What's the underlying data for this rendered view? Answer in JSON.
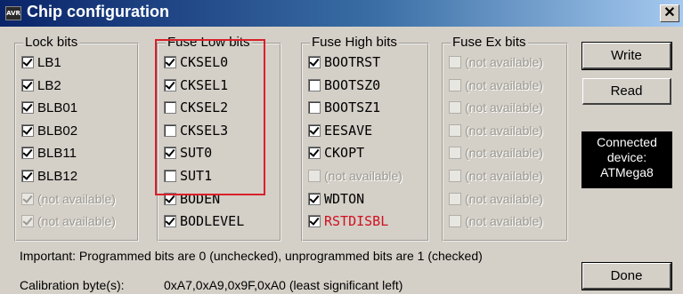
{
  "window": {
    "title": "Chip configuration",
    "app_icon_text": "AVR",
    "close_symbol": "✕"
  },
  "lock_bits": {
    "title": "Lock bits",
    "items": [
      {
        "label": "LB1",
        "checked": true,
        "available": true
      },
      {
        "label": "LB2",
        "checked": true,
        "available": true
      },
      {
        "label": "BLB01",
        "checked": true,
        "available": true
      },
      {
        "label": "BLB02",
        "checked": true,
        "available": true
      },
      {
        "label": "BLB11",
        "checked": true,
        "available": true
      },
      {
        "label": "BLB12",
        "checked": true,
        "available": true
      },
      {
        "label": "(not available)",
        "checked": true,
        "available": false
      },
      {
        "label": "(not available)",
        "checked": true,
        "available": false
      }
    ]
  },
  "fuse_low": {
    "title": "Fuse Low bits",
    "items": [
      {
        "label": "CKSEL0",
        "checked": true
      },
      {
        "label": "CKSEL1",
        "checked": true
      },
      {
        "label": "CKSEL2",
        "checked": false
      },
      {
        "label": "CKSEL3",
        "checked": false
      },
      {
        "label": "SUT0",
        "checked": true
      },
      {
        "label": "SUT1",
        "checked": false
      },
      {
        "label": "BODEN",
        "checked": true
      },
      {
        "label": "BODLEVEL",
        "checked": true
      }
    ]
  },
  "fuse_high": {
    "title": "Fuse High bits",
    "items": [
      {
        "label": "BOOTRST",
        "checked": true
      },
      {
        "label": "BOOTSZ0",
        "checked": false
      },
      {
        "label": "BOOTSZ1",
        "checked": false
      },
      {
        "label": "EESAVE",
        "checked": true
      },
      {
        "label": "CKOPT",
        "checked": true
      },
      {
        "label": "(not available)",
        "checked": false
      },
      {
        "label": "WDTON",
        "checked": true
      },
      {
        "label": "RSTDISBL",
        "checked": true
      }
    ]
  },
  "fuse_ex": {
    "title": "Fuse Ex bits",
    "items": [
      {
        "label": "(not available)"
      },
      {
        "label": "(not available)"
      },
      {
        "label": "(not available)"
      },
      {
        "label": "(not available)"
      },
      {
        "label": "(not available)"
      },
      {
        "label": "(not available)"
      },
      {
        "label": "(not available)"
      },
      {
        "label": "(not available)"
      }
    ]
  },
  "buttons": {
    "write": "Write",
    "read": "Read",
    "done": "Done"
  },
  "device": {
    "line1": "Connected",
    "line2": "device:",
    "line3": "ATMega8"
  },
  "note": "Important: Programmed bits are 0 (unchecked), unprogrammed bits are 1 (checked)",
  "calibration": {
    "label": "Calibration byte(s):",
    "value": "0xA7,0xA9,0x9F,0xA0 (least significant left)"
  },
  "colors": {
    "highlight_box": "#d8202a",
    "rstdisbl_text": "#d01020",
    "title_bar_start": "#0a246a"
  }
}
